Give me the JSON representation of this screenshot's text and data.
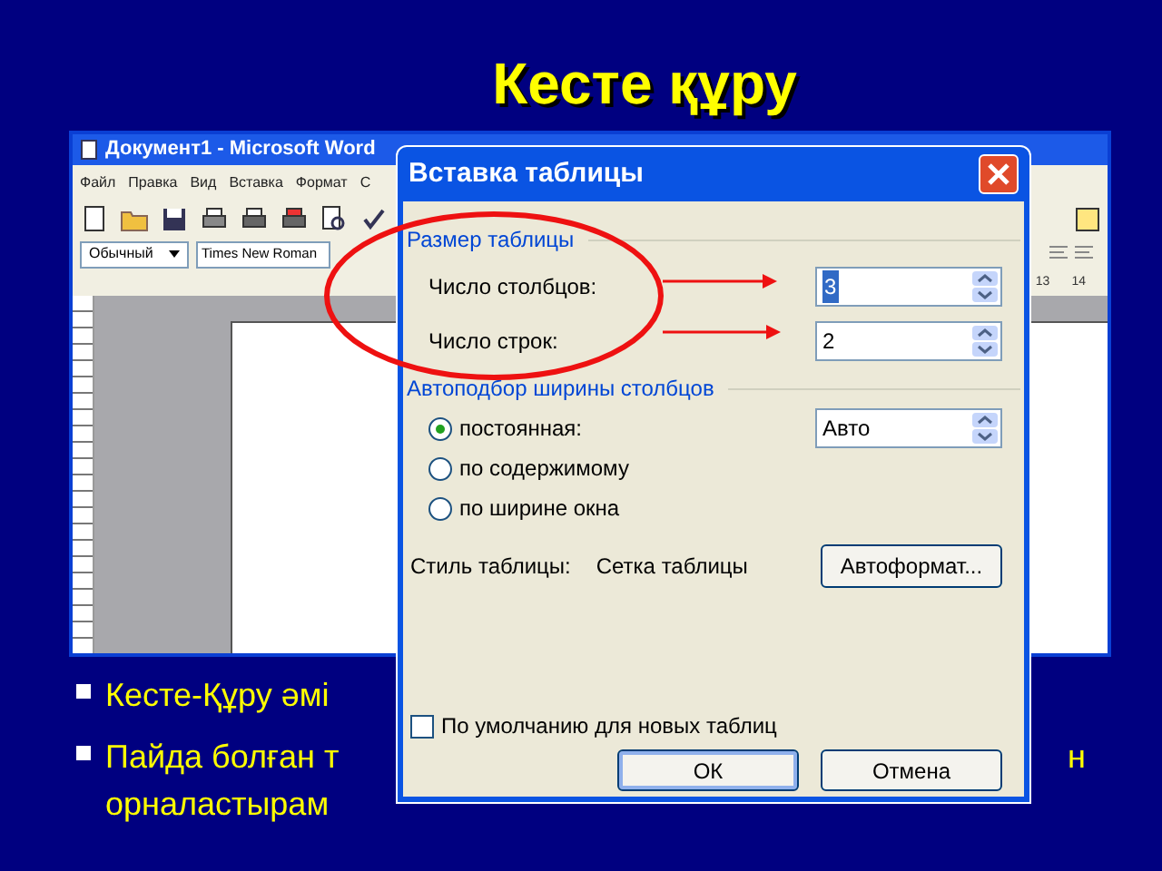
{
  "slide": {
    "title": "Кесте құру"
  },
  "word_window": {
    "title": "Документ1 - Microsoft Word",
    "menu": [
      "Файл",
      "Правка",
      "Вид",
      "Вставка",
      "Формат",
      "С"
    ],
    "style_box": "Обычный",
    "font_box": "Times New Roman",
    "ruler_numbers": [
      "13",
      "14"
    ]
  },
  "dialog": {
    "title": "Вставка таблицы",
    "size_group": {
      "label": "Размер таблицы",
      "fields": [
        {
          "label": "Число столбцов:",
          "value": "3",
          "selected": true
        },
        {
          "label": "Число строк:",
          "value": "2",
          "selected": false
        }
      ]
    },
    "autofit_group": {
      "label": "Автоподбор ширины столбцов",
      "options": [
        {
          "label": "постоянная:",
          "selected": true,
          "value": "Авто"
        },
        {
          "label": "по содержимому",
          "selected": false
        },
        {
          "label": "по ширине окна",
          "selected": false
        }
      ]
    },
    "style": {
      "label": "Стиль таблицы:",
      "value": "Сетка таблицы",
      "button": "Автоформат..."
    },
    "default_checkbox": {
      "label": "По умолчанию для новых таблиц",
      "checked": false
    },
    "buttons": [
      {
        "label": "ОК",
        "default": true
      },
      {
        "label": "Отмена",
        "default": false
      }
    ]
  },
  "bullets": [
    {
      "lines": [
        [
          "Кесте-Құру әмі"
        ]
      ]
    },
    {
      "lines": [
        [
          "Пайда болған т",
          "н"
        ],
        [
          "орналастырам"
        ]
      ]
    }
  ]
}
